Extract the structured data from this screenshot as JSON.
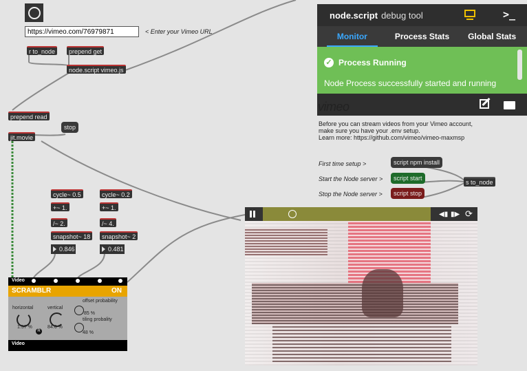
{
  "patch": {
    "url_value": "https://vimeo.com/76979871",
    "url_comment": "< Enter your Vimeo URL",
    "r_to_node": "r to_node",
    "prepend_get": "prepend get",
    "node_script": "node.script vimeo.js",
    "prepend_read": "prepend read",
    "stop": "stop",
    "jit_movie": "jit.movie",
    "cycle_left": "cycle~ 0.5",
    "plus_left": "+~ 1.",
    "div_left": "/~ 2.",
    "snap_left": "snapshot~ 18",
    "num_left": "0.846",
    "cycle_right": "cycle~ 0.2",
    "plus_right": "+~ 1.",
    "div_right": "/~ 4.",
    "snap_right": "snapshot~ 2",
    "num_right": "0.481",
    "s_to_node": "s to_node"
  },
  "debug": {
    "title_bold": "node.script",
    "title_rest": "debug tool",
    "tabs": [
      "Monitor",
      "Process Stats",
      "Global Stats"
    ],
    "active_tab": "Monitor",
    "status_title": "Process Running",
    "status_message": "Node Process successfully started and running",
    "accent": "#3aa8ff",
    "status_color": "#6fbf56"
  },
  "info": {
    "logo": "vimeo",
    "line1": "Before you can stream videos from your Vimeo account,",
    "line2": "make sure you have your .env setup.",
    "line3": "Learn more: https://github.com/vimeo/vimeo-maxmsp",
    "setup_label": "First time setup >",
    "setup_button": "script npm install",
    "start_label": "Start the Node server >",
    "start_button": "script start",
    "stop_label": "Stop the Node server >",
    "stop_button": "script stop"
  },
  "scramblr": {
    "top_label": "Video",
    "title": "SCRAMBLR",
    "state": "ON",
    "horizontal_label": "horizontal",
    "horizontal_value": "1.57 %",
    "vertical_label": "vertical",
    "vertical_value": "84.6 %",
    "offset_label": "offset probability",
    "offset_value": "85 %",
    "tiling_label": "tiling probality",
    "tiling_value": "48 %",
    "r_badge": "R",
    "bottom_label": "Video"
  }
}
